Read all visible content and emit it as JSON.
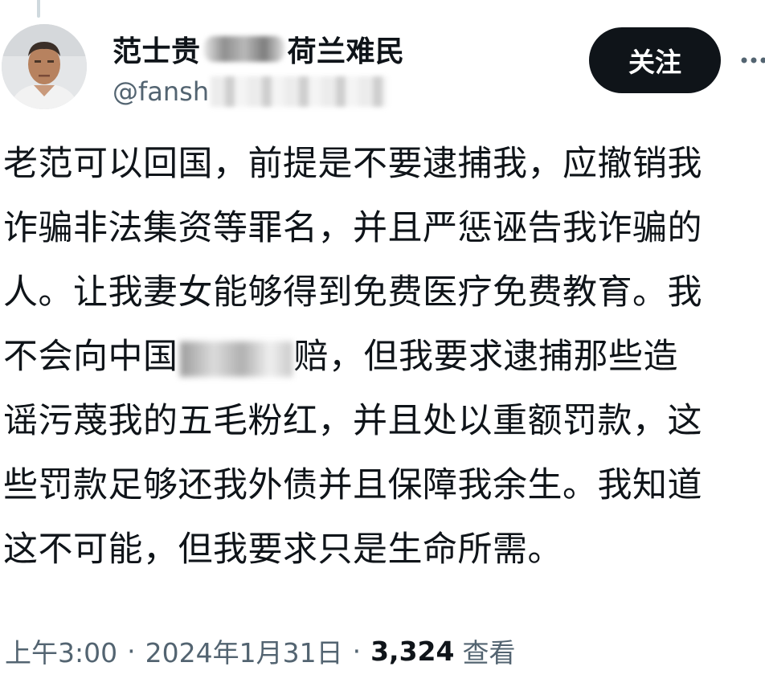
{
  "header": {
    "display_name_start": "范士贵",
    "display_name_end": "荷兰难民",
    "handle": "@fansh",
    "follow_label": "关注"
  },
  "tweet": {
    "lines": [
      "老范可以回国，前提是不要逮捕我，应撤销我",
      "诈骗非法集资等罪名，并且严惩诬告我诈骗的",
      "人。让我妻女能够得到免费医疗免费教育。我",
      "",
      "谣污蔑我的五毛粉红，并且处以重额罚款，这",
      "些罚款足够还我外债并且保障我余生。我知道",
      "这不可能，但我要求只是生命所需。"
    ],
    "line4_start": "不会向中国",
    "line4_end": "赔，但我要求逮捕那些造"
  },
  "meta": {
    "time": "上午3:00",
    "separator": "·",
    "date": "2024年1月31日",
    "views_count": "3,324",
    "views_label": "查看"
  },
  "colors": {
    "text": "#0f1419",
    "secondary": "#536471",
    "button_bg": "#0f1419",
    "button_text": "#ffffff"
  }
}
